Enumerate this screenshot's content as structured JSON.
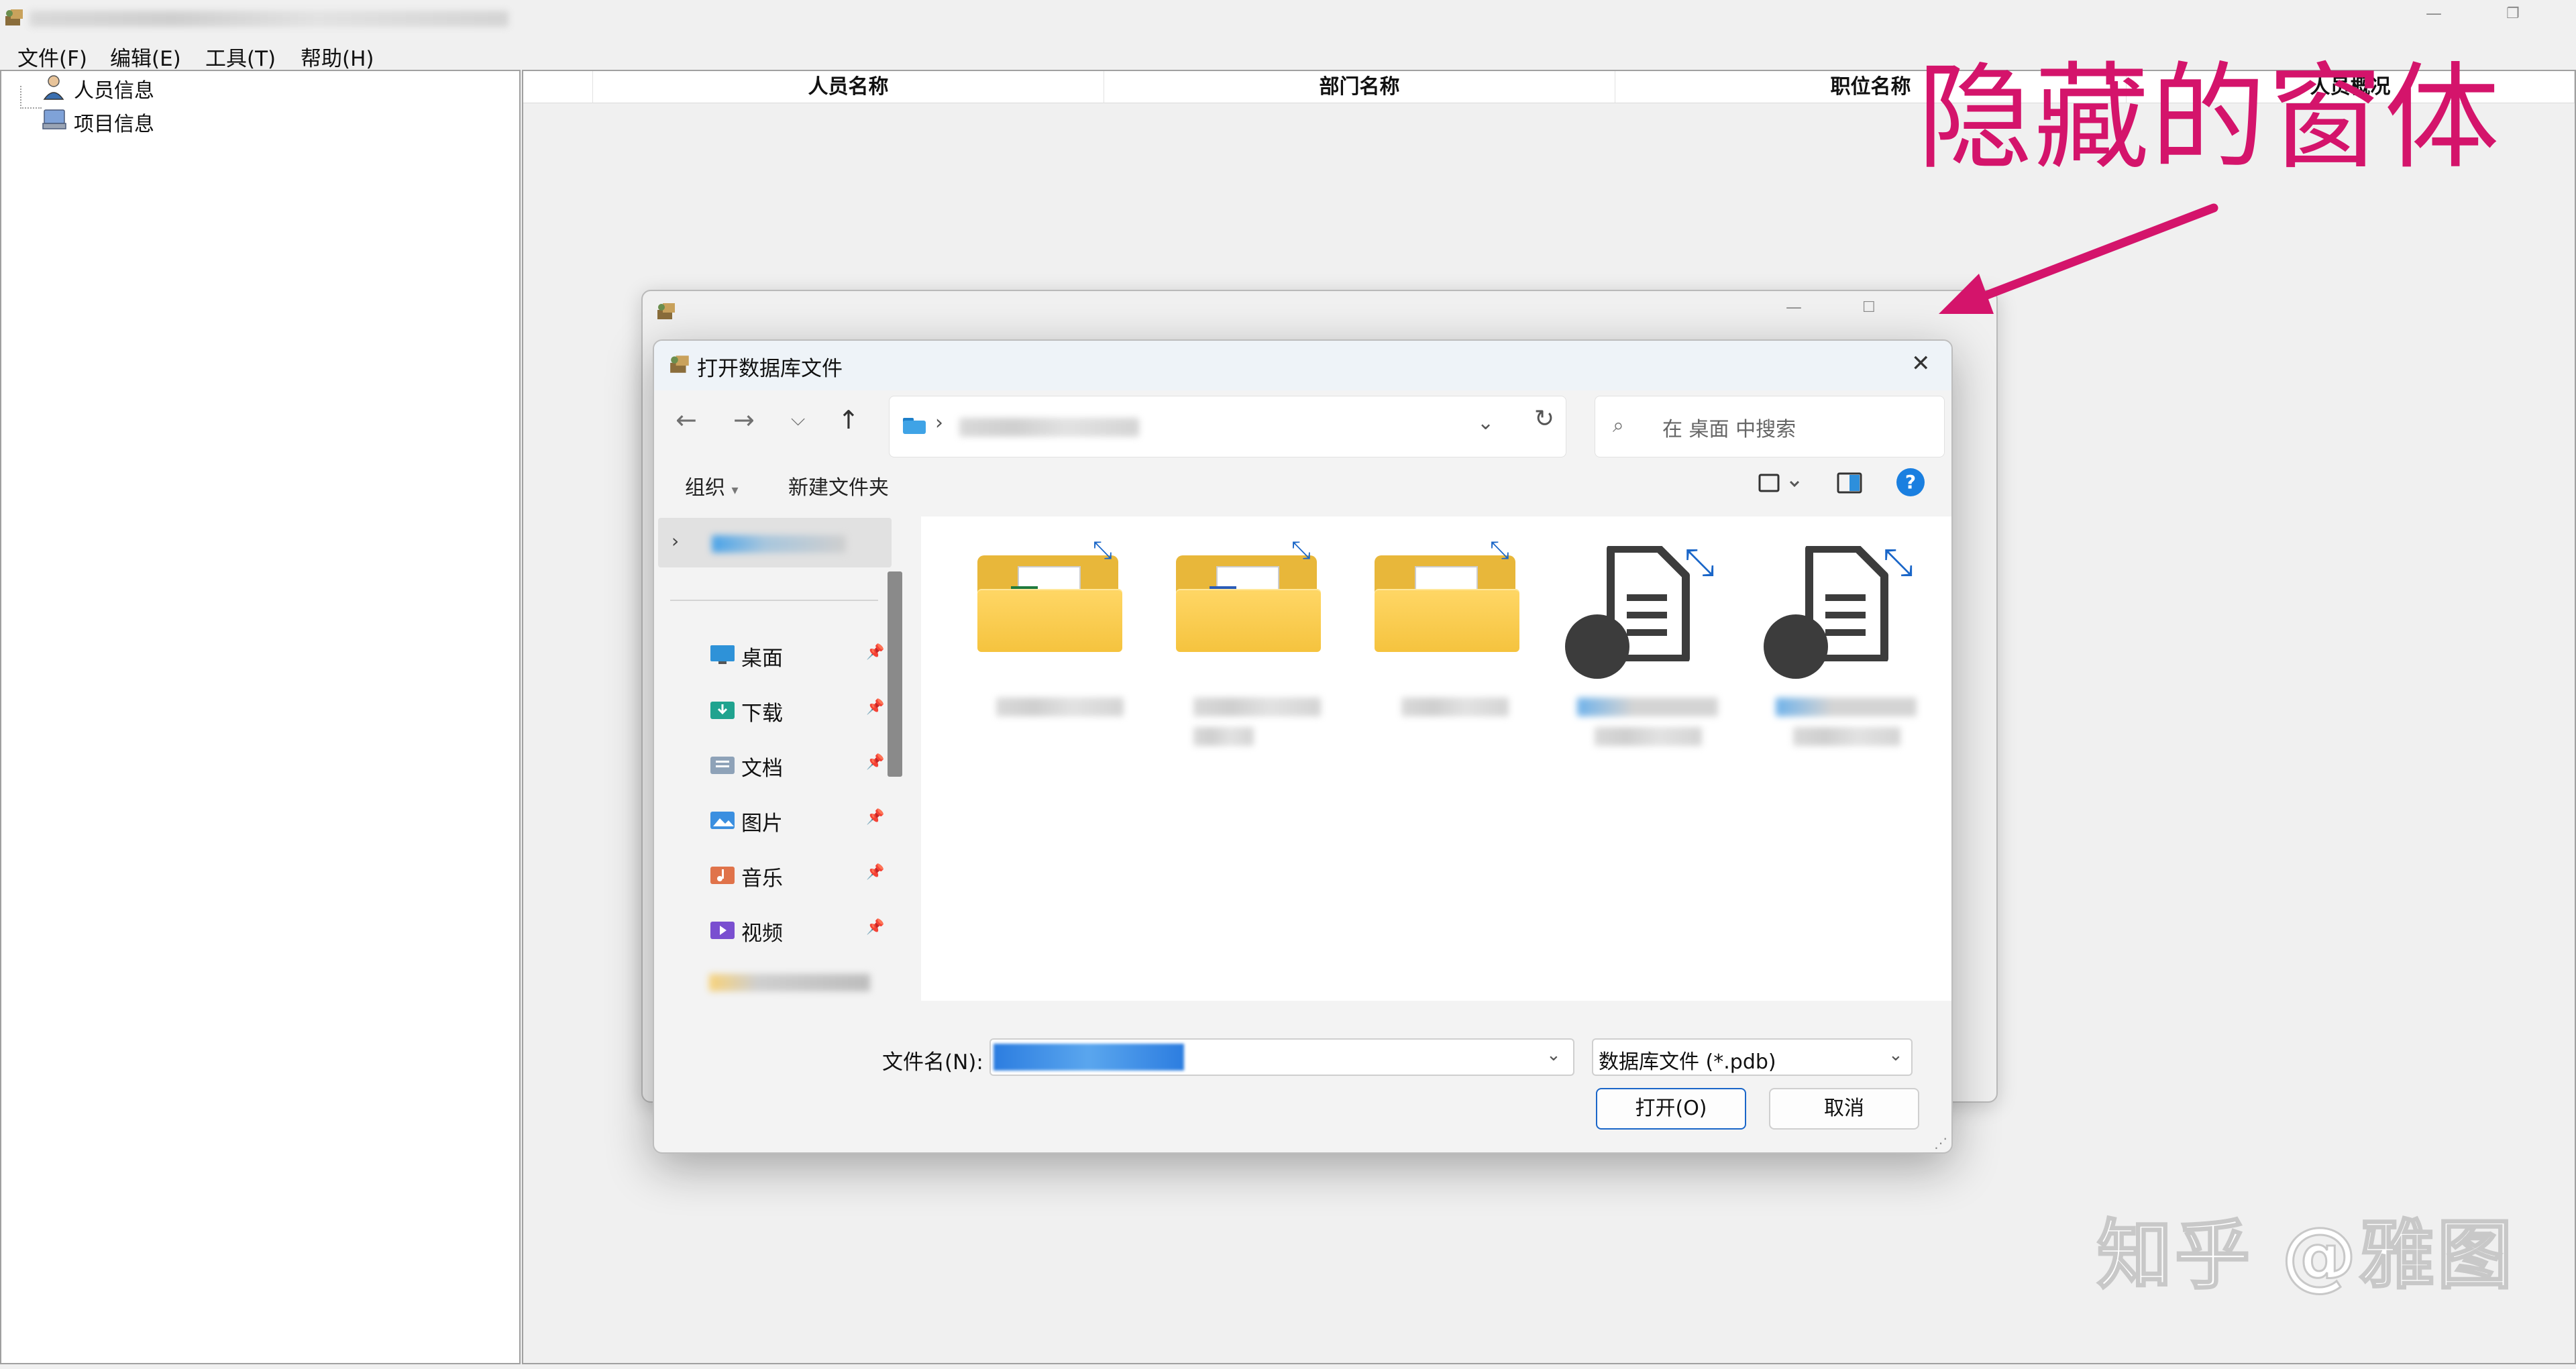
{
  "menu": {
    "file": "文件(F)",
    "edit": "编辑(E)",
    "tools": "工具(T)",
    "help": "帮助(H)"
  },
  "tree": {
    "people": "人员信息",
    "projects": "项目信息"
  },
  "table": {
    "columns": [
      "人员名称",
      "部门名称",
      "职位名称",
      "人员概况"
    ]
  },
  "dialog": {
    "title": "打开数据库文件",
    "search_placeholder": "在 桌面 中搜索",
    "organize": "组织",
    "new_folder": "新建文件夹",
    "quick_access": [
      {
        "label": "桌面",
        "icon": "desktop-icon"
      },
      {
        "label": "下载",
        "icon": "download-icon"
      },
      {
        "label": "文档",
        "icon": "documents-icon"
      },
      {
        "label": "图片",
        "icon": "pictures-icon"
      },
      {
        "label": "音乐",
        "icon": "music-icon"
      },
      {
        "label": "视频",
        "icon": "videos-icon"
      }
    ],
    "filename_label": "文件名(N):",
    "filetype": "数据库文件 (*.pdb)",
    "open_button": "打开(O)",
    "cancel_button": "取消"
  },
  "annotation": {
    "text": "隐藏的窗体"
  },
  "watermark": {
    "text": "知乎 @雅图"
  },
  "colors": {
    "annotation": "#d4146b",
    "accent": "#1a66c8",
    "folder": "#f5c33e"
  }
}
